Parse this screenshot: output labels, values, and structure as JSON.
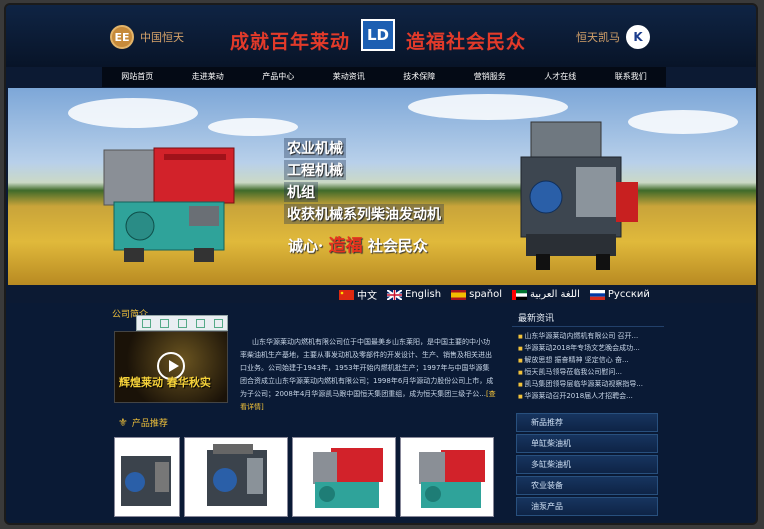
{
  "header": {
    "left_brand": "中国恒天",
    "left_logo_glyph": "EE",
    "slogan_left": "成就百年莱动",
    "slogan_right": "造福社会民众",
    "center_logo": "LD",
    "right_brand": "恒天凯马",
    "right_logo_glyph": "K"
  },
  "nav": {
    "items": [
      "网站首页",
      "走进莱动",
      "产品中心",
      "莱动资讯",
      "技术保障",
      "营销服务",
      "人才在线",
      "联系我们"
    ]
  },
  "banner": {
    "lines": [
      "农业机械",
      "工程机械",
      "机组",
      "收获机械系列柴油发动机"
    ],
    "sub_left": "诚心·",
    "sub_mid": "造福",
    "sub_right": "社会民众"
  },
  "languages": [
    {
      "label": "中文",
      "flag": "cn"
    },
    {
      "label": "English",
      "flag": "uk"
    },
    {
      "label": "spaňol",
      "flag": "es"
    },
    {
      "label": "اللغة العربية",
      "flag": "ae"
    },
    {
      "label": "Русский",
      "flag": "ru"
    }
  ],
  "about": {
    "title": "公司简介",
    "video_caption": "辉煌莱动 春华秋实",
    "text": "山东华源莱动内燃机有限公司位于中国最美乡山东莱阳，是中国主要的中小功率柴油机生产基地，主要从事发动机及零部件的开发设计、生产、销售及相关进出口业务。公司始建于1943年，1953年开始内燃机批生产；1997年与中国华源集团合资成立山东华源莱动内燃机有限公司；1998年6月华源动力股份公司上市，成为子公司；2008年4月华源凯马跟中国恒天集团重组，成为恒天集团三级子公...",
    "more": "[查看详情]"
  },
  "products": {
    "title": "产品推荐"
  },
  "news": {
    "title": "最新资讯",
    "items": [
      "山东华源莱动内燃机有限公司 召开...",
      "华源莱动2018年专场文艺晚会成功...",
      "解放思想 振奋精神 坚定信心 奋...",
      "恒天凯马领导莅临我公司慰问...",
      "凯马集团领导层临华源莱动视察指导...",
      "华源莱动召开2018届人才招聘会..."
    ]
  },
  "categories": [
    "新品推荐",
    "单缸柴油机",
    "多缸柴油机",
    "农业装备",
    "油泵产品"
  ]
}
